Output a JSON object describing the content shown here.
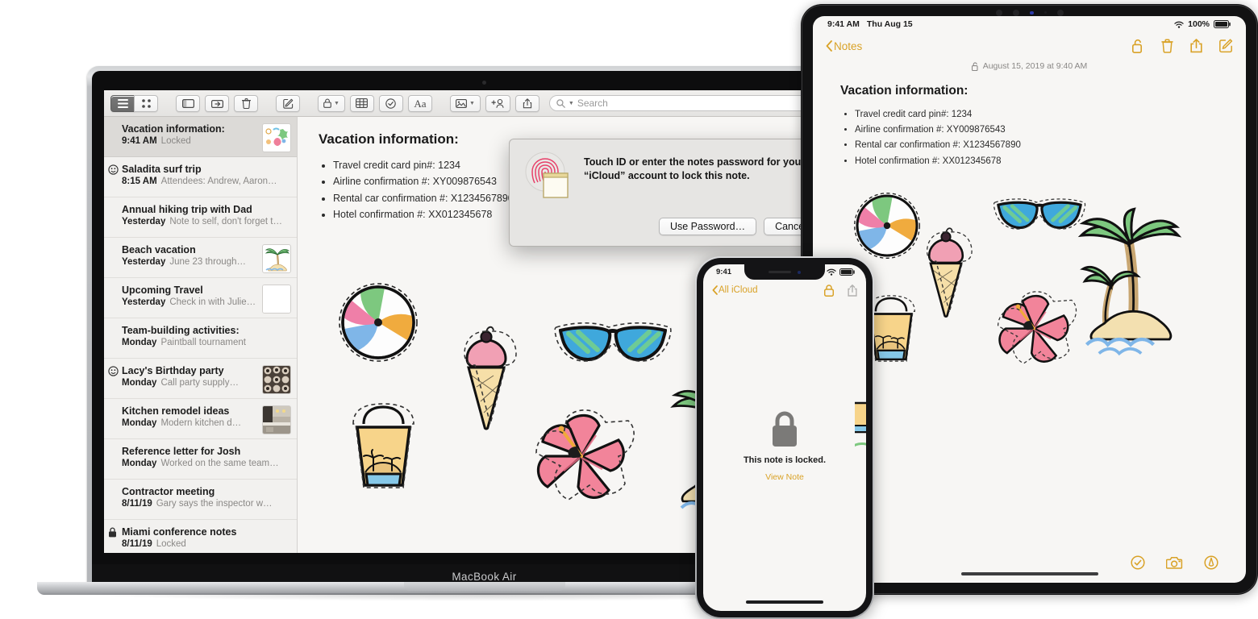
{
  "mac": {
    "model_label": "MacBook Air",
    "toolbar": {
      "view_list": "list-view",
      "view_grid": "grid-view",
      "sidebar": "sidebar-toggle",
      "folder": "move-to-folder",
      "delete": "delete-note",
      "compose": "new-note",
      "lock": "lock-note",
      "table": "insert-table",
      "checklist": "checklist",
      "format": "Aa",
      "media": "insert-media",
      "collaborate": "add-people",
      "share": "share",
      "search_placeholder": "Search"
    },
    "notes": [
      {
        "title": "Vacation information:",
        "date": "9:41 AM",
        "snippet": "Locked",
        "lead": "none",
        "thumb": "stickers",
        "selected": true
      },
      {
        "title": "Saladita surf trip",
        "date": "8:15 AM",
        "snippet": "Attendees: Andrew, Aaron…",
        "lead": "shared",
        "thumb": "none",
        "selected": false
      },
      {
        "title": "Annual hiking trip with Dad",
        "date": "Yesterday",
        "snippet": "Note to self, don't forget t…",
        "lead": "none",
        "thumb": "none",
        "selected": false
      },
      {
        "title": "Beach vacation",
        "date": "Yesterday",
        "snippet": "June 23 through…",
        "lead": "none",
        "thumb": "palm",
        "selected": false
      },
      {
        "title": "Upcoming Travel",
        "date": "Yesterday",
        "snippet": "Check in with Julie…",
        "lead": "none",
        "thumb": "blank",
        "selected": false
      },
      {
        "title": "Team-building activities:",
        "date": "Monday",
        "snippet": "Paintball tournament",
        "lead": "none",
        "thumb": "none",
        "selected": false
      },
      {
        "title": "Lacy's Birthday party",
        "date": "Monday",
        "snippet": "Call party supply…",
        "lead": "shared",
        "thumb": "cupcakes",
        "selected": false
      },
      {
        "title": "Kitchen remodel ideas",
        "date": "Monday",
        "snippet": "Modern kitchen d…",
        "lead": "none",
        "thumb": "kitchen",
        "selected": false
      },
      {
        "title": "Reference letter for Josh",
        "date": "Monday",
        "snippet": "Worked on the same team…",
        "lead": "none",
        "thumb": "none",
        "selected": false
      },
      {
        "title": "Contractor meeting",
        "date": "8/11/19",
        "snippet": "Gary says the inspector w…",
        "lead": "none",
        "thumb": "none",
        "selected": false
      },
      {
        "title": "Miami conference notes",
        "date": "8/11/19",
        "snippet": "Locked",
        "lead": "lock",
        "thumb": "none",
        "selected": false
      }
    ],
    "note_detail": {
      "title": "Vacation information:",
      "bullets": [
        "Travel credit card pin#: 1234",
        "Airline confirmation #: XY009876543",
        "Rental car confirmation #: X1234567890",
        "Hotel confirmation #: XX012345678"
      ]
    },
    "dialog": {
      "message": "Touch ID or enter the notes password for your “iCloud” account to lock this note.",
      "primary_button": "Use Password…",
      "secondary_button": "Cancel",
      "icon": "touch-id-note-icon"
    }
  },
  "ipad": {
    "status": {
      "time": "9:41 AM",
      "date": "Thu Aug 15",
      "battery": "100%",
      "wifi": "wifi-icon"
    },
    "nav": {
      "back_label": "Notes",
      "unlock": "unlock-icon",
      "delete": "trash-icon",
      "share": "share-icon",
      "compose": "compose-icon"
    },
    "meta": {
      "lock_icon": "unlocked-icon",
      "timestamp": "August 15, 2019 at 9:40 AM"
    },
    "note": {
      "title": "Vacation information:",
      "bullets": [
        "Travel credit card pin#: 1234",
        "Airline confirmation #: XY009876543",
        "Rental car confirmation #: X1234567890",
        "Hotel confirmation #: XX012345678"
      ]
    },
    "bottom_bar": {
      "checklist": "checklist-icon",
      "camera": "camera-icon",
      "markup": "markup-icon"
    }
  },
  "iphone": {
    "status": {
      "time": "9:41",
      "cellular": "signal-icon",
      "wifi": "wifi-icon",
      "battery": "battery-icon"
    },
    "nav": {
      "back_label": "All iCloud",
      "lock": "lock-icon",
      "share": "share-icon"
    },
    "locked": {
      "icon": "lock-icon",
      "message": "This note is locked.",
      "action": "View Note"
    }
  },
  "colors": {
    "accent": "#d9a227",
    "text": "#1c1c1c",
    "muted": "#8a8886",
    "surface": "#f7f6f4",
    "sidebar": "#f2f1ef",
    "selected_row": "#dcdad7"
  }
}
